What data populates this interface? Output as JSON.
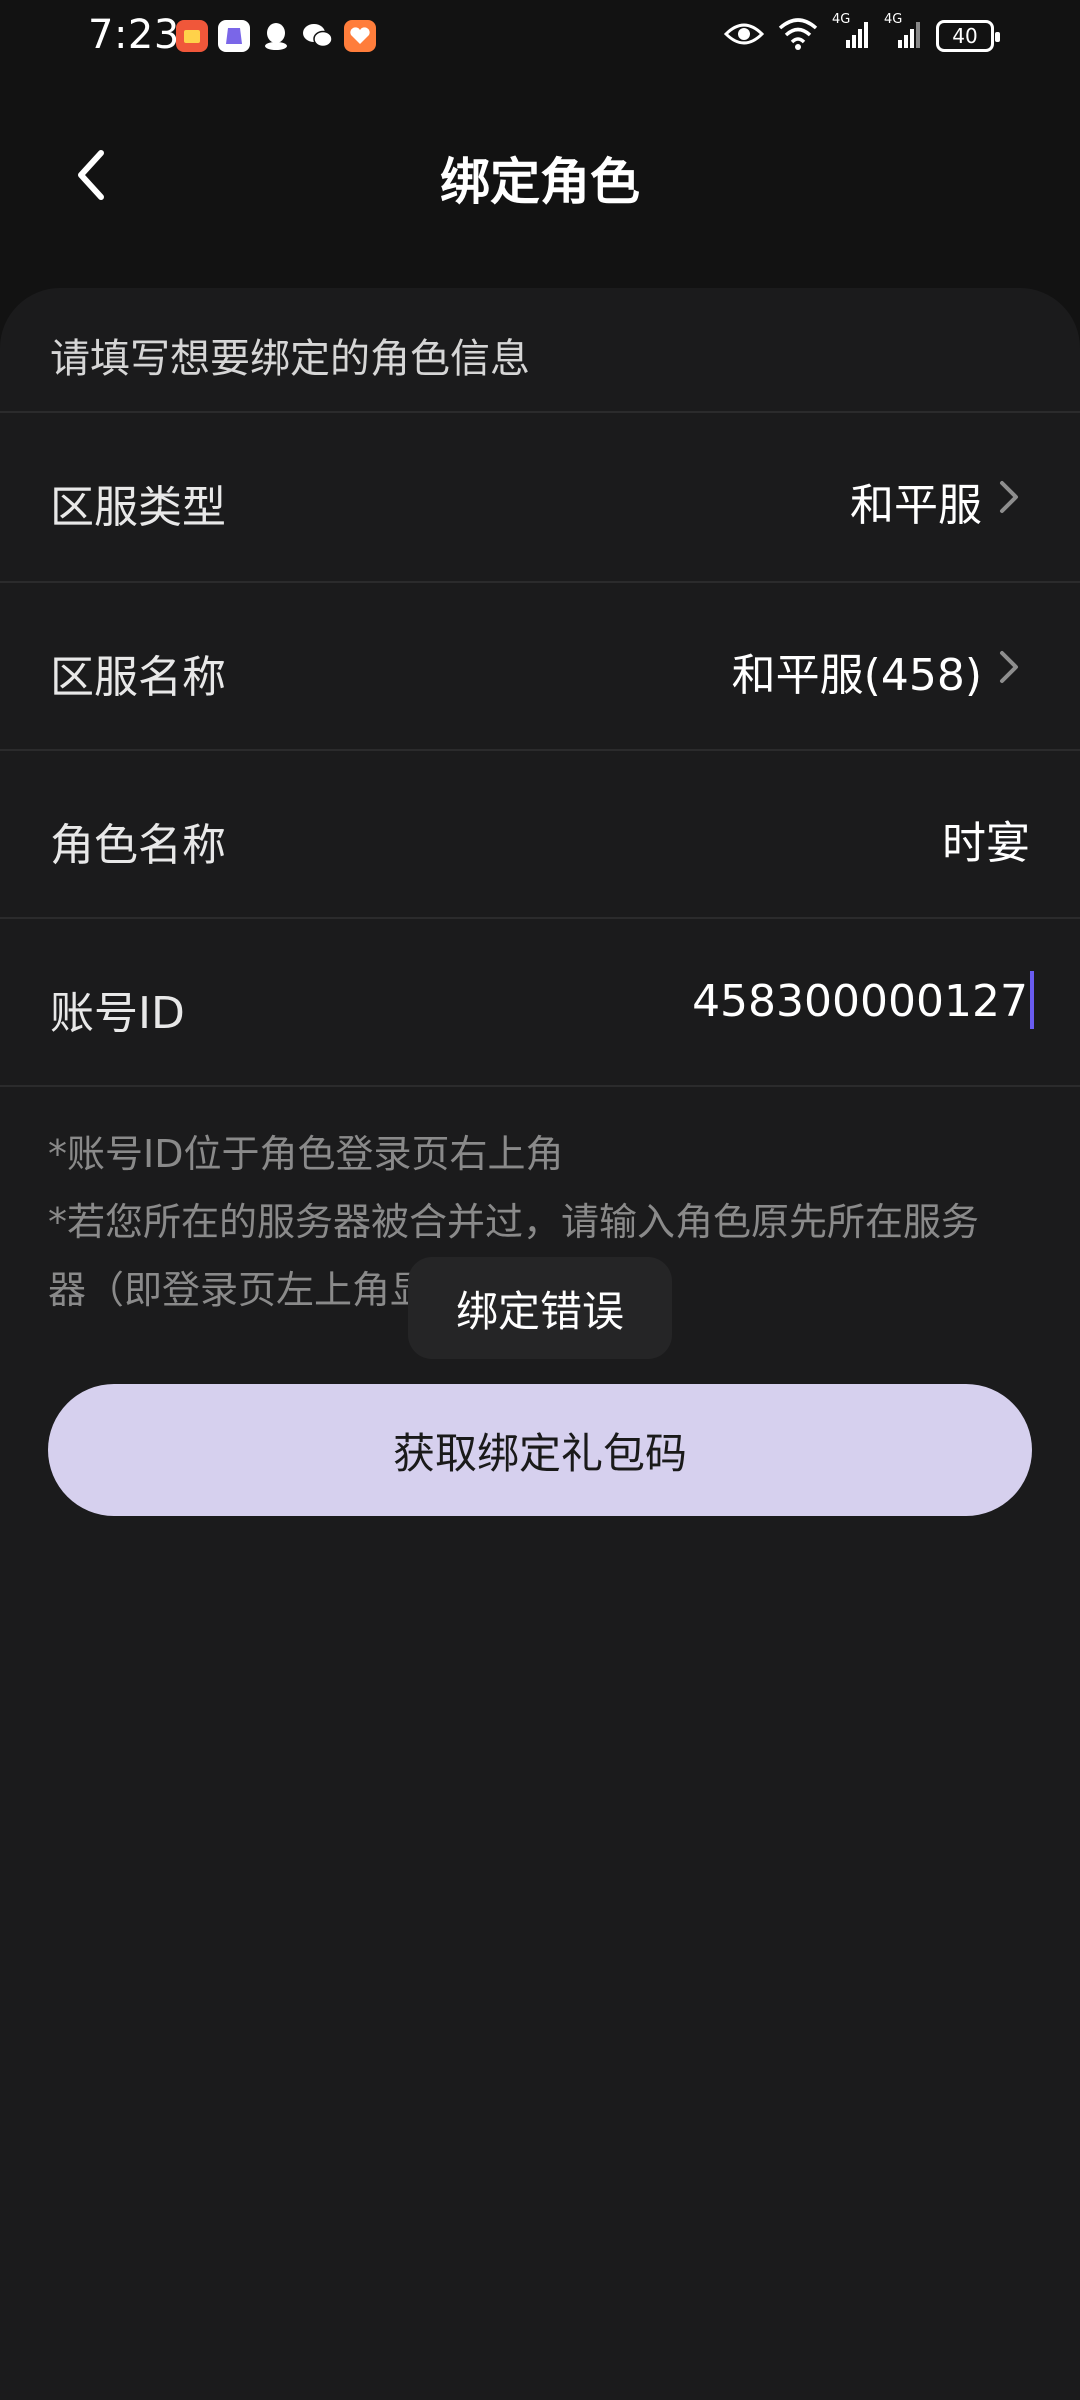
{
  "status_bar": {
    "time": "7:23",
    "battery": "40",
    "net_label_1": "4G",
    "net_label_2": "4G",
    "app_icons": [
      "shopping-app-icon",
      "game-app-icon",
      "qq-icon",
      "wechat-icon",
      "health-app-icon"
    ]
  },
  "header": {
    "title": "绑定角色"
  },
  "form": {
    "hint": "请填写想要绑定的角色信息",
    "rows": [
      {
        "label": "区服类型",
        "value": "和平服"
      },
      {
        "label": "区服名称",
        "value": "和平服(458)"
      },
      {
        "label": "角色名称",
        "value": "时宴"
      },
      {
        "label": "账号ID",
        "value": "458300000127"
      }
    ]
  },
  "notes": {
    "line1": "*账号ID位于角色登录页右上角",
    "line2": "*若您所在的服务器被合并过，请输入角色原先所在服务",
    "line3": "器（即登录页左上角显"
  },
  "toast": {
    "text": "绑定错误"
  },
  "button": {
    "label": "获取绑定礼包码"
  },
  "colors": {
    "background": "#121212",
    "card": "#1b1b1c",
    "button": "#d6d0ee",
    "caret": "#6a5cf0"
  }
}
